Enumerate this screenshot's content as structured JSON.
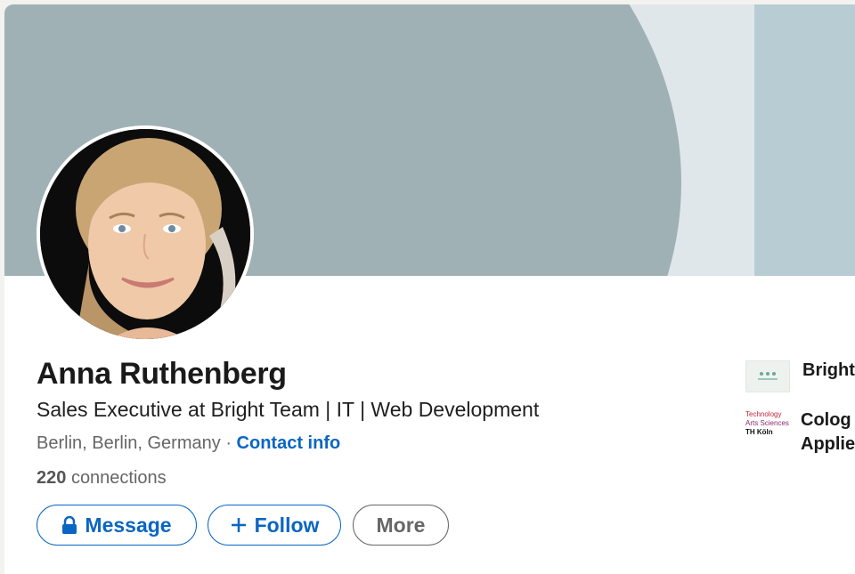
{
  "profile": {
    "name": "Anna Ruthenberg",
    "headline": "Sales Executive at Bright Team | IT | Web Development",
    "location": "Berlin, Berlin, Germany",
    "separator": "·",
    "contact_info_label": "Contact info",
    "connections_count": "220",
    "connections_label": "connections"
  },
  "actions": {
    "message_label": "Message",
    "follow_label": "Follow",
    "more_label": "More"
  },
  "sidebar": {
    "company": {
      "label": "Bright"
    },
    "education": {
      "line1": "Colog",
      "line2": "Applie",
      "logo_text_1": "Technology",
      "logo_text_2": "Arts Sciences",
      "logo_text_3": "TH Köln"
    }
  },
  "colors": {
    "brand_blue": "#0a66c2",
    "banner_primary": "#9fb1b5",
    "banner_secondary": "#b7cdd3"
  },
  "icons": {
    "message": "lock-icon",
    "follow": "plus-icon"
  }
}
